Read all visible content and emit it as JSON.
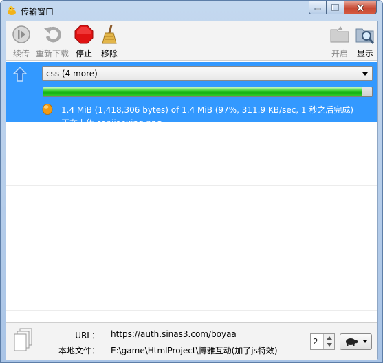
{
  "window": {
    "title": "传输窗口"
  },
  "toolbar": {
    "resume_label": "续传",
    "redownload_label": "重新下载",
    "stop_label": "停止",
    "remove_label": "移除",
    "open_label": "开启",
    "show_label": "显示"
  },
  "transfer": {
    "selected_file": "css (4 more)",
    "progress_fraction": 0.97,
    "status_line": "1.4 MiB (1,418,306 bytes) of 1.4 MiB (97%, 311.9 KB/sec, 1 秒之后完成)",
    "current_file_line": "正在上传 sanjiaoxing.png",
    "accent_color": "#3399ff"
  },
  "details": {
    "url_label": "URL：",
    "url_value": "https://auth.sinas3.com/boyaa",
    "local_label": "本地文件：",
    "local_value": "E:\\game\\HtmlProject\\博雅互动(加了js特效)"
  },
  "controls": {
    "concurrency_value": "2",
    "speed_icon": "turtle-icon"
  }
}
